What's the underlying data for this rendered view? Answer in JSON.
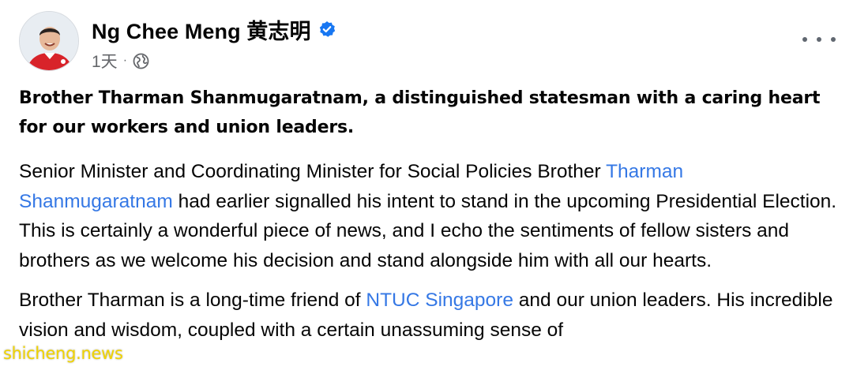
{
  "post": {
    "author": {
      "name": "Ng Chee Meng 黄志明",
      "verified": true,
      "timestamp": "1天",
      "separator": "·",
      "audience_icon": "globe-icon"
    },
    "more_icon": "more-options-icon",
    "headline": "Brother Tharman Shanmugaratnam, a distinguished statesman with a caring heart for our workers and union leaders.",
    "paragraph1": {
      "before_link": "Senior Minister and Coordinating Minister for Social Policies Brother ",
      "link": "Tharman Shanmugaratnam",
      "after_link": " had earlier signalled his intent to stand in the upcoming Presidential Election. This is certainly a wonderful piece of news, and I echo the sentiments of fellow sisters and brothers as we welcome his decision and stand alongside him with all our hearts."
    },
    "paragraph2": {
      "before_link": "Brother Tharman is a long-time friend of ",
      "link": "NTUC Singapore",
      "after_link": " and our union leaders. His incredible vision and wisdom, coupled with a certain unassuming sense of"
    }
  },
  "watermark": "shicheng.news",
  "colors": {
    "link": "#3578e5",
    "meta": "#65676b",
    "verified": "#1877f2",
    "watermark": "#f0d300"
  }
}
